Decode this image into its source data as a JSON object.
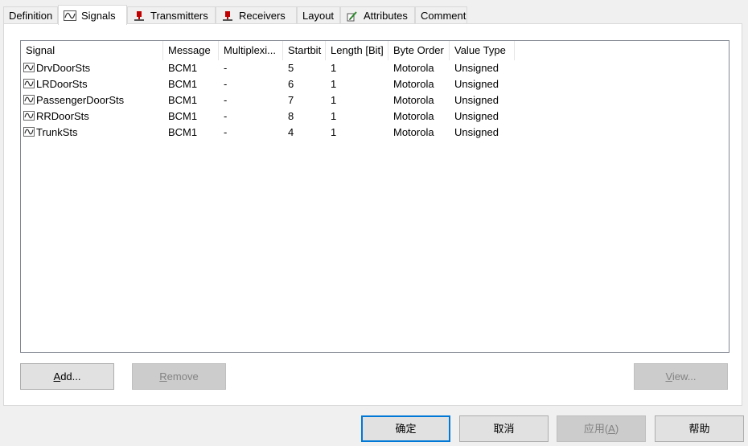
{
  "tabs": [
    {
      "label": "Definition",
      "icon": "none"
    },
    {
      "label": "Signals",
      "icon": "signal-icon"
    },
    {
      "label": "Transmitters",
      "icon": "transmitter-icon"
    },
    {
      "label": "Receivers",
      "icon": "receiver-icon"
    },
    {
      "label": "Layout",
      "icon": "none"
    },
    {
      "label": "Attributes",
      "icon": "attributes-icon"
    },
    {
      "label": "Comment",
      "icon": "none"
    }
  ],
  "table": {
    "columns": [
      "Signal",
      "Message",
      "Multiplexi...",
      "Startbit",
      "Length [Bit]",
      "Byte Order",
      "Value Type"
    ],
    "rows": [
      [
        "DrvDoorSts",
        "BCM1",
        "-",
        "5",
        "1",
        "Motorola",
        "Unsigned"
      ],
      [
        "LRDoorSts",
        "BCM1",
        "-",
        "6",
        "1",
        "Motorola",
        "Unsigned"
      ],
      [
        "PassengerDoorSts",
        "BCM1",
        "-",
        "7",
        "1",
        "Motorola",
        "Unsigned"
      ],
      [
        "RRDoorSts",
        "BCM1",
        "-",
        "8",
        "1",
        "Motorola",
        "Unsigned"
      ],
      [
        "TrunkSts",
        "BCM1",
        "-",
        "4",
        "1",
        "Motorola",
        "Unsigned"
      ]
    ]
  },
  "buttons": {
    "add_mnemonic": "A",
    "add_rest": "dd...",
    "remove_mnemonic": "R",
    "remove_rest": "emove",
    "view_mnemonic": "V",
    "view_rest": "iew..."
  },
  "dialog": {
    "ok": "确定",
    "cancel": "取消",
    "apply_pre": "应用(",
    "apply_mnemonic": "A",
    "apply_post": ")",
    "help": "帮助"
  },
  "colors": {
    "accent": "#0078d7",
    "signal_icon": "#4a4a4a",
    "transmitter_red": "#c00000"
  }
}
